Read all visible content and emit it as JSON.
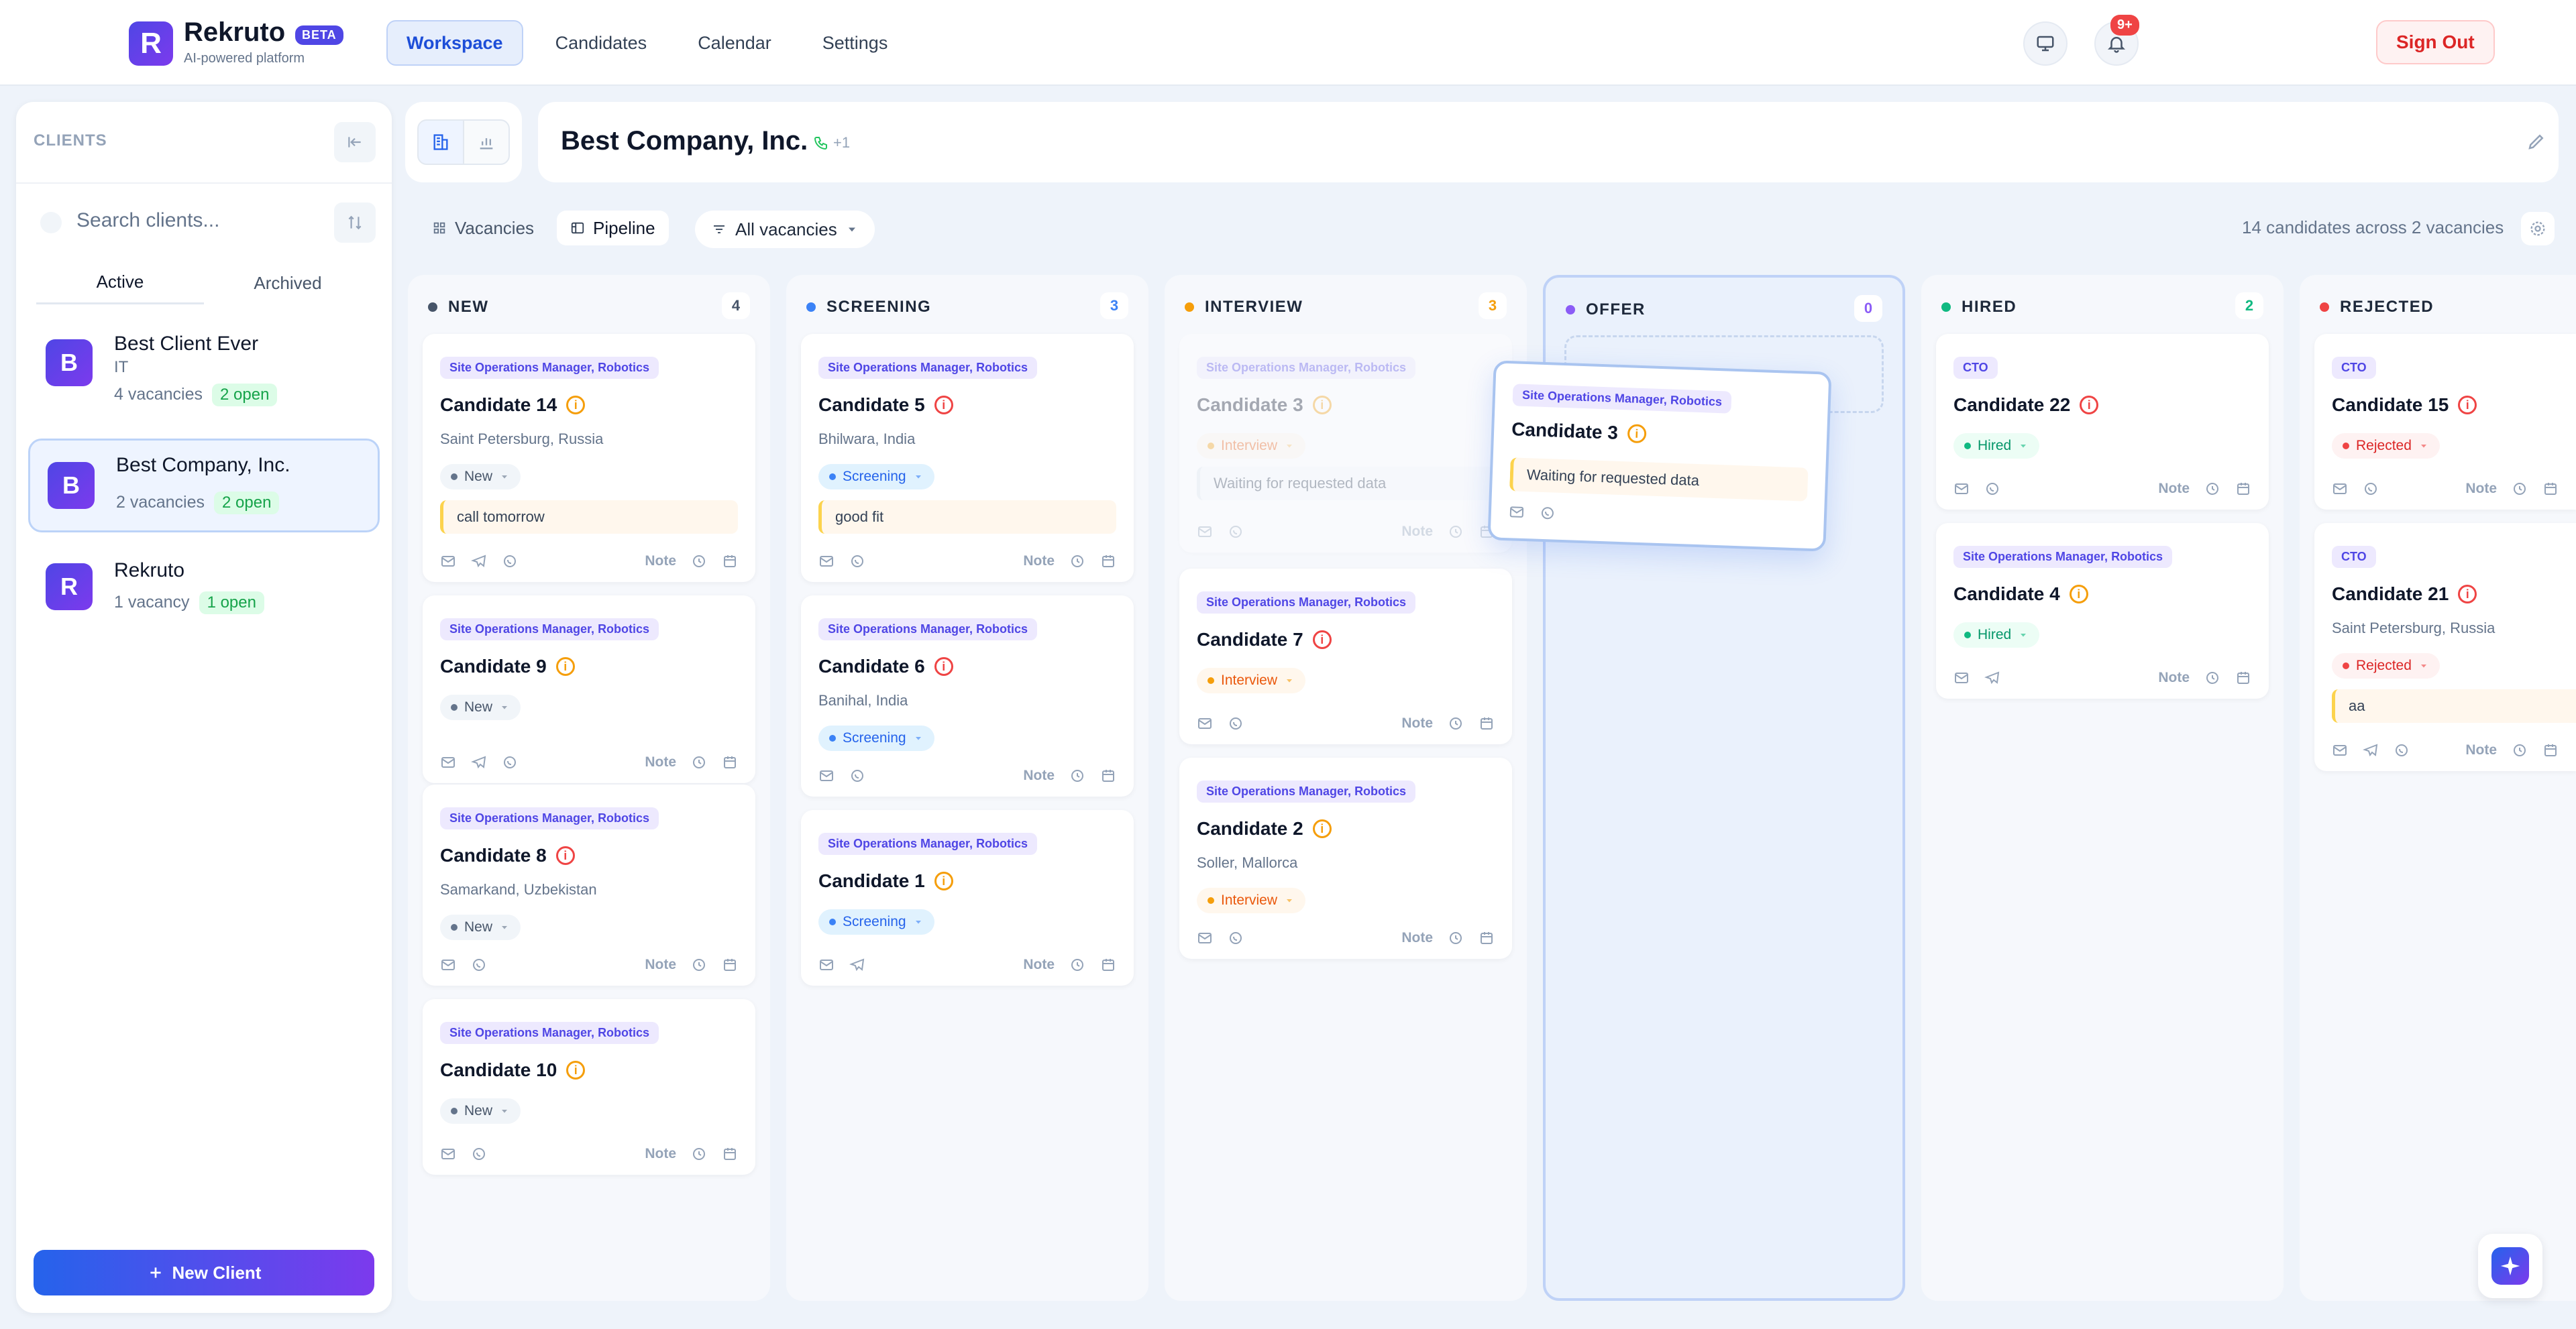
{
  "app": {
    "logo_letter": "R",
    "name": "Rekruto",
    "badge": "BETA",
    "tagline": "AI-powered platform"
  },
  "nav": [
    "Workspace",
    "Candidates",
    "Calendar",
    "Settings"
  ],
  "notifications": "9+",
  "sign_out": "Sign Out",
  "sidebar": {
    "title": "CLIENTS",
    "search_placeholder": "Search clients...",
    "tabs": [
      "Active",
      "Archived"
    ],
    "clients": [
      {
        "initial": "B",
        "name": "Best Client Ever",
        "industry": "IT",
        "vacancies": "4 vacancies",
        "open": "2 open"
      },
      {
        "initial": "B",
        "name": "Best Company, Inc.",
        "industry": "",
        "vacancies": "2 vacancies",
        "open": "2 open"
      },
      {
        "initial": "R",
        "name": "Rekruto",
        "industry": "",
        "vacancies": "1 vacancy",
        "open": "1 open"
      }
    ],
    "new_client": "New Client"
  },
  "company": {
    "name": "Best Company, Inc.",
    "phone_extra": "+1"
  },
  "toolbar": {
    "vacancies": "Vacancies",
    "pipeline": "Pipeline",
    "filter": "All vacancies",
    "summary": "14 candidates across 2 vacancies"
  },
  "note_label": "Note",
  "columns": [
    {
      "name": "NEW",
      "count": "4",
      "color": "#475569"
    },
    {
      "name": "SCREENING",
      "count": "3",
      "color": "#3b82f6"
    },
    {
      "name": "INTERVIEW",
      "count": "3",
      "color": "#f59e0b"
    },
    {
      "name": "OFFER",
      "count": "0",
      "color": "#8b5cf6"
    },
    {
      "name": "HIRED",
      "count": "2",
      "color": "#10b981"
    },
    {
      "name": "REJECTED",
      "count": "",
      "color": "#ef4444"
    }
  ],
  "cards": {
    "c14": {
      "tag": "Site Operations Manager, Robotics",
      "name": "Candidate 14",
      "loc": "Saint Petersburg, Russia",
      "status": "New",
      "note": "call tomorrow"
    },
    "c9": {
      "tag": "Site Operations Manager, Robotics",
      "name": "Candidate 9",
      "status": "New"
    },
    "c8": {
      "tag": "Site Operations Manager, Robotics",
      "name": "Candidate 8",
      "loc": "Samarkand, Uzbekistan",
      "status": "New"
    },
    "c10": {
      "tag": "Site Operations Manager, Robotics",
      "name": "Candidate 10",
      "status": "New"
    },
    "c5": {
      "tag": "Site Operations Manager, Robotics",
      "name": "Candidate 5",
      "loc": "Bhilwara, India",
      "status": "Screening",
      "note": "good fit"
    },
    "c6": {
      "tag": "Site Operations Manager, Robotics",
      "name": "Candidate 6",
      "loc": "Banihal, India",
      "status": "Screening"
    },
    "c1": {
      "tag": "Site Operations Manager, Robotics",
      "name": "Candidate 1",
      "status": "Screening"
    },
    "c3": {
      "tag": "Site Operations Manager, Robotics",
      "name": "Candidate 3",
      "status": "Interview",
      "note": "Waiting for requested data"
    },
    "c7": {
      "tag": "Site Operations Manager, Robotics",
      "name": "Candidate 7",
      "status": "Interview"
    },
    "c2": {
      "tag": "Site Operations Manager, Robotics",
      "name": "Candidate 2",
      "loc": "Soller, Mallorca",
      "status": "Interview"
    },
    "c22": {
      "tag": "CTO",
      "name": "Candidate 22",
      "status": "Hired"
    },
    "c4": {
      "tag": "Site Operations Manager, Robotics",
      "name": "Candidate 4",
      "status": "Hired"
    },
    "c15": {
      "tag": "CTO",
      "name": "Candidate 15",
      "status": "Rejected"
    },
    "c21": {
      "tag": "CTO",
      "name": "Candidate 21",
      "loc": "Saint Petersburg, Russia",
      "status": "Rejected",
      "note": "aa"
    }
  }
}
